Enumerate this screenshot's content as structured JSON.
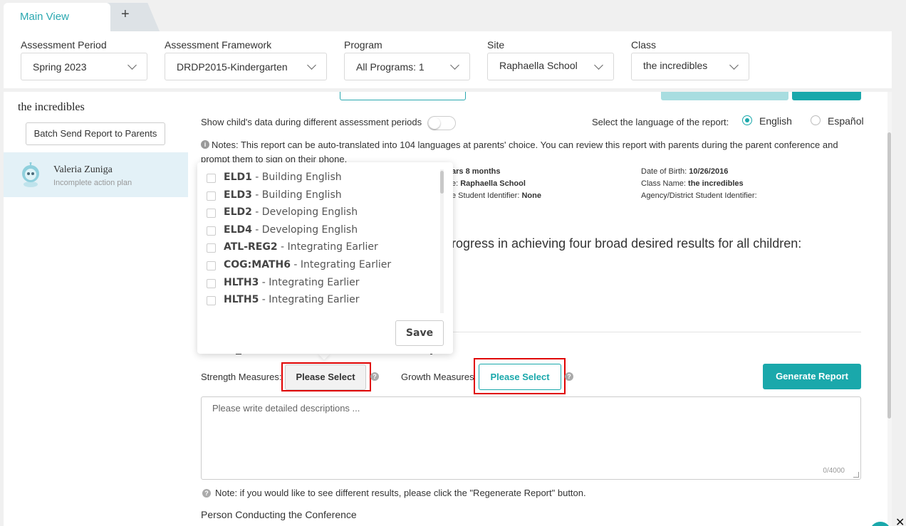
{
  "tabs": {
    "main": "Main View",
    "add": "+"
  },
  "filters": {
    "assessment_period": {
      "label": "Assessment Period",
      "value": "Spring 2023"
    },
    "assessment_framework": {
      "label": "Assessment Framework",
      "value": "DRDP2015-Kindergarten"
    },
    "program": {
      "label": "Program",
      "value": "All Programs: 1"
    },
    "site": {
      "label": "Site",
      "value": "Raphaella School"
    },
    "class": {
      "label": "Class",
      "value": "the incredibles"
    }
  },
  "sidebar": {
    "class_title": "the incredibles",
    "batch_button": "Batch Send Report to Parents",
    "child": {
      "name": "Valeria Zuniga",
      "status": "Incomplete action plan"
    }
  },
  "report": {
    "show_data_label": "Show child's data during different assessment periods",
    "language_label": "Select the language of the report:",
    "lang_english": "English",
    "lang_espanol": "Español",
    "notes": "Notes: This report can be auto-translated into 104 languages at parents' choice. You can review this report with parents during the parent conference and prompt them to sign on their phone.",
    "info": {
      "age_tail": "ars 8 months",
      "site_prefix": "e: ",
      "site_value": "Raphaella School",
      "sid_prefix": "e Student Identifier: ",
      "sid_value": "None",
      "dob_label": "Date of Birth: ",
      "dob_value": "10/26/2016",
      "classname_label": "Class Name: ",
      "classname_value": "the incredibles",
      "agency_label": "Agency/District Student Identifier:"
    },
    "progress_text": "rogress in achieving four broad desired results for all children:",
    "strength_label": "Strength Measures:",
    "strength_button": "Please Select",
    "growth_label": "Growth Measures",
    "growth_button": "Please Select",
    "generate_button": "Generate Report",
    "textarea_placeholder": "Please write detailed descriptions ...",
    "char_count": "0/4000",
    "note2": "Note: if you would like to see different results, please click the \"Regenerate Report\" button.",
    "person_label": "Person Conducting the Conference"
  },
  "dropdown": {
    "options": [
      {
        "code": "ELD1",
        "desc": " - Building English"
      },
      {
        "code": "ELD3",
        "desc": " - Building English"
      },
      {
        "code": "ELD2",
        "desc": " - Developing English"
      },
      {
        "code": "ELD4",
        "desc": " - Developing English"
      },
      {
        "code": "ATL-REG2",
        "desc": " - Integrating Earlier"
      },
      {
        "code": "COG:MATH6",
        "desc": " - Integrating Earlier"
      },
      {
        "code": "HLTH3",
        "desc": " - Integrating Earlier"
      },
      {
        "code": "HLTH5",
        "desc": " - Integrating Earlier"
      }
    ],
    "save": "Save"
  },
  "icons": {
    "close": "close-icon",
    "info": "info-icon",
    "help": "help-icon",
    "chevron": "chevron-down-icon"
  },
  "colors": {
    "accent": "#1aa8ab",
    "highlight": "#e00000",
    "selected_row": "#e3f1f7"
  }
}
